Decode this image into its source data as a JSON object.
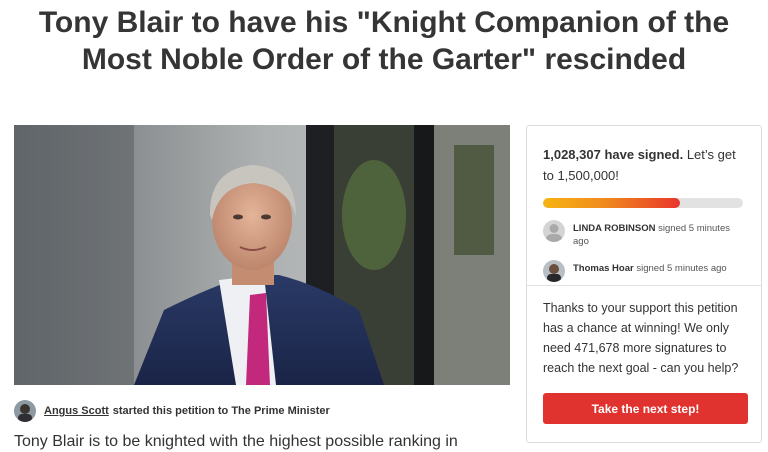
{
  "title": {
    "line1": "Tony Blair to have his \"Knight Companion of the",
    "line2": "Most Noble Order of the Garter\" rescinded"
  },
  "starter": {
    "author": "Angus Scott",
    "text": "started this petition to The Prime Minister"
  },
  "body": {
    "first_line": "Tony Blair is to be knighted with the highest possible ranking in"
  },
  "sidebar": {
    "signed_count": "1,028,307 have signed.",
    "goal_text": "Let’s get to 1,500,000!",
    "progress_fraction": 0.686,
    "recent_signers": [
      {
        "name": "LINDA ROBINSON",
        "action": "signed 5 minutes ago"
      },
      {
        "name": "Thomas Hoar",
        "action": "signed 5 minutes ago"
      }
    ],
    "cta_message": "Thanks to your support this petition has a chance at winning! We only need 471,678 more signatures to reach the next goal - can you help?",
    "cta_button": "Take the next step!"
  },
  "colors": {
    "accent": "#e0332f",
    "progress_start": "#f7b413",
    "progress_end": "#e8362c"
  }
}
